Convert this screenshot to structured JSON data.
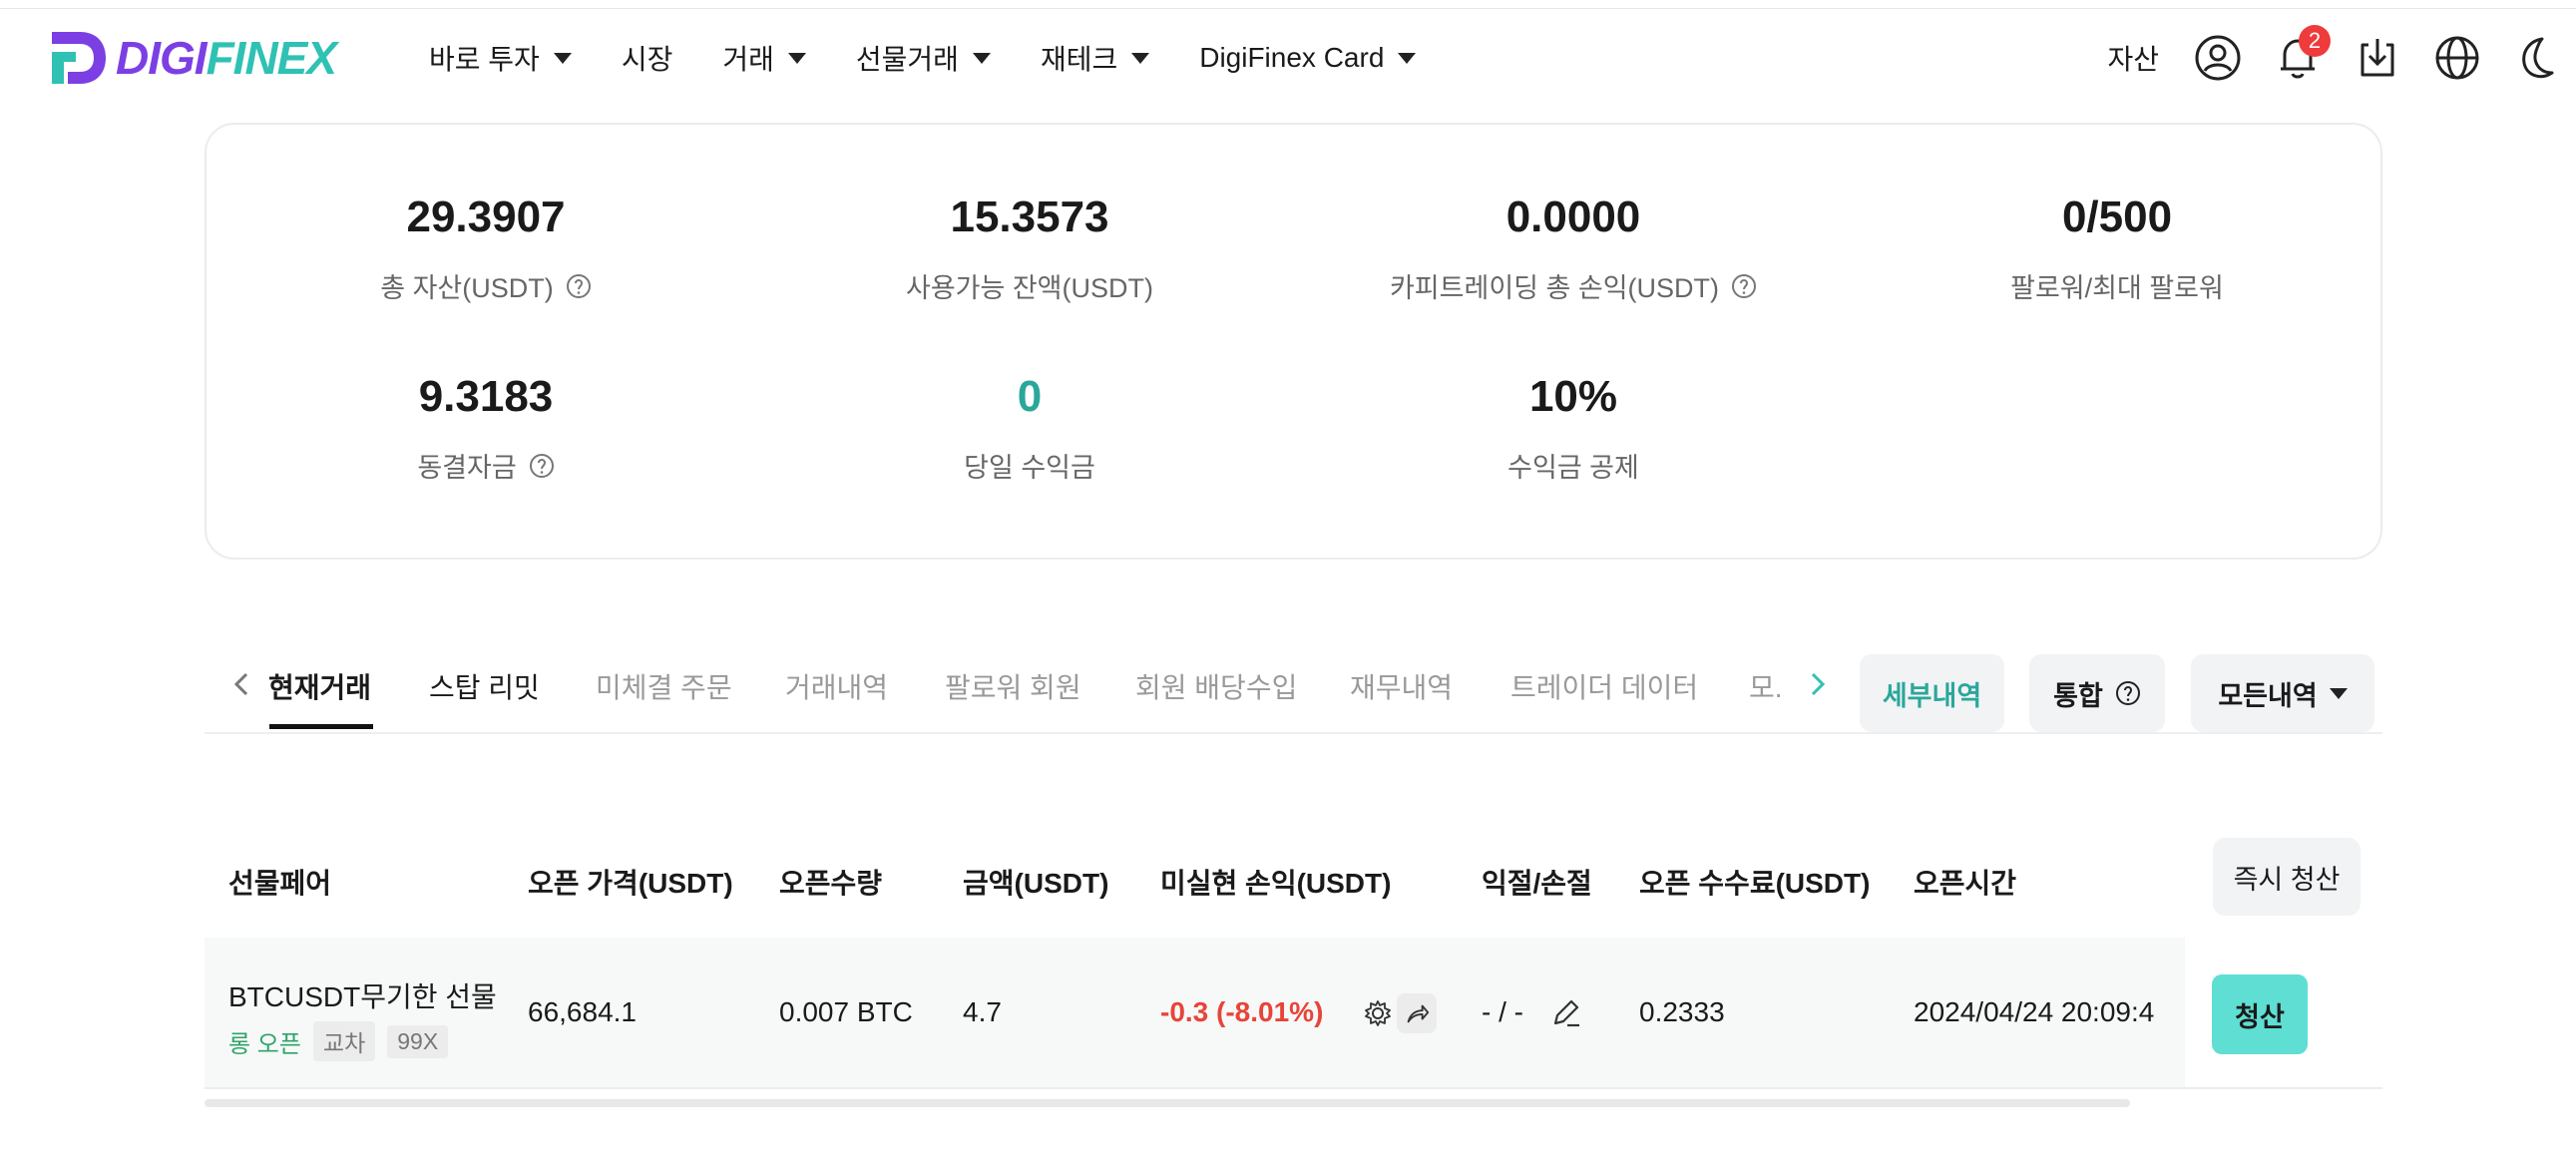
{
  "header": {
    "logo_text": "DIGIFINEX",
    "nav": [
      {
        "label": "바로 투자",
        "has_caret": true
      },
      {
        "label": "시장",
        "has_caret": false
      },
      {
        "label": "거래",
        "has_caret": true
      },
      {
        "label": "선물거래",
        "has_caret": true
      },
      {
        "label": "재테크",
        "has_caret": true
      },
      {
        "label": "DigiFinex Card",
        "has_caret": true
      }
    ],
    "assets_label": "자산",
    "notification_count": "2",
    "icons": [
      "user-icon",
      "bell-icon",
      "download-icon",
      "globe-icon",
      "moon-icon"
    ]
  },
  "stats": {
    "total_assets": {
      "value": "29.3907",
      "label": "총 자산(USDT)"
    },
    "available_balance": {
      "value": "15.3573",
      "label": "사용가능 잔액(USDT)"
    },
    "copy_pnl": {
      "value": "0.0000",
      "label": "카피트레이딩 총 손익(USDT)"
    },
    "followers": {
      "value": "0/500",
      "label": "팔로워/최대 팔로워"
    },
    "frozen": {
      "value": "9.3183",
      "label": "동결자금"
    },
    "today_profit": {
      "value": "0",
      "label": "당일 수익금"
    },
    "profit_share": {
      "value": "10%",
      "label": "수익금 공제"
    }
  },
  "tabs": {
    "items": [
      "현재거래",
      "스탑 리밋",
      "미체결 주문",
      "거래내역",
      "팔로워 회원",
      "회원 배당수입",
      "재무내역",
      "트레이더 데이터",
      "모."
    ],
    "active_index": 0,
    "detail_button": "세부내역",
    "merge_button": "통합",
    "all_history_button": "모든내역"
  },
  "table": {
    "headers": [
      "선물페어",
      "오픈 가격(USDT)",
      "오픈수량",
      "금액(USDT)",
      "미실현 손익(USDT)",
      "익절/손절",
      "오픈 수수료(USDT)",
      "오픈시간"
    ],
    "close_all_button": "즉시 청산",
    "rows": [
      {
        "pair": "BTCUSDT무기한 선물",
        "side": "롱 오픈",
        "margin_mode": "교차",
        "leverage": "99X",
        "open_price": "66,684.1",
        "quantity": "0.007 BTC",
        "amount": "4.7",
        "unrealized_pnl": "-0.3 (-8.01%)",
        "tp_sl": "- / -",
        "open_fee": "0.2333",
        "open_time": "2024/04/24 20:09:4",
        "close_button": "청산"
      }
    ]
  },
  "colors": {
    "brand_purple": "#7b3fe4",
    "brand_teal": "#2fc1b3",
    "positive_teal": "#2aa79a",
    "negative_red": "#e8443a",
    "close_button_bg": "#5fded3",
    "badge_red": "#ef3b3b"
  }
}
